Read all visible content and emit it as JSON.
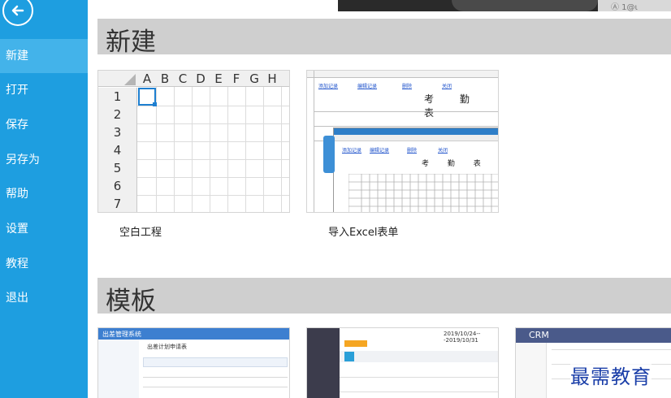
{
  "sidebar": {
    "back_label": "back",
    "items": [
      {
        "label": "新建",
        "active": true
      },
      {
        "label": "打开"
      },
      {
        "label": "保存"
      },
      {
        "label": "另存为"
      },
      {
        "label": "帮助"
      },
      {
        "label": "设置"
      },
      {
        "label": "教程"
      },
      {
        "label": "退出"
      }
    ]
  },
  "top_strip": {
    "text": "Ⓐ 1@ι"
  },
  "sections": {
    "new": {
      "title": "新建",
      "cards": [
        {
          "label": "空白工程",
          "columns": [
            "A",
            "B",
            "C",
            "D",
            "E",
            "F",
            "G",
            "H"
          ],
          "rows": [
            "1",
            "2",
            "3",
            "4",
            "5",
            "6",
            "7"
          ]
        },
        {
          "label": "导入Excel表单",
          "links": [
            "添加记录",
            "编辑记录",
            "删除",
            "关闭"
          ],
          "sheet_title": "考 勤 表",
          "popup_links": [
            "添加记录",
            "编辑记录",
            "删除",
            "关闭"
          ],
          "popup_title": "考 勤 表"
        }
      ]
    },
    "templates": {
      "title": "模板",
      "cards": [
        {
          "header": "出差管理系统",
          "subtitle": "出差计划申请表"
        },
        {
          "header": "2019/10/24---2019/10/31"
        },
        {
          "header": "CRM"
        }
      ]
    }
  },
  "watermark": "最需教育",
  "colors": {
    "sidebar": "#1e9ee0",
    "sidebar_active": "#43b3ea",
    "section_header": "#cfcfcf",
    "selection": "#1e7fd0",
    "template_header_blue": "#3d7fd0",
    "template_header_dark": "#3c3c4c",
    "crm_header": "#4a5a8a"
  }
}
